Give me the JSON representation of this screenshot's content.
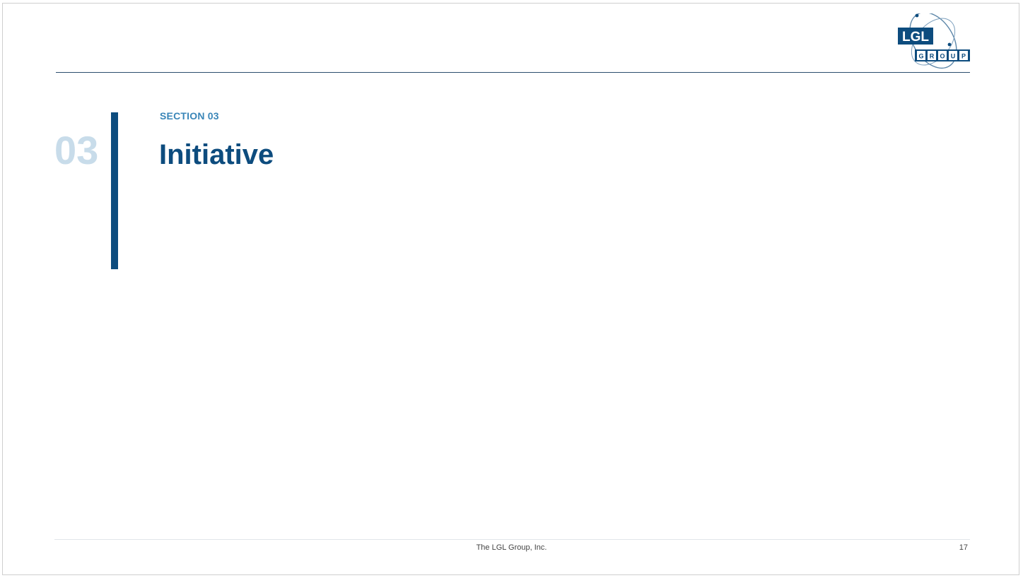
{
  "logo": {
    "line1": "LGL",
    "line2_letters": [
      "G",
      "R",
      "O",
      "U",
      "P"
    ],
    "icon": "lgl-orbit-logo",
    "colors": {
      "primary": "#0d4c7e",
      "orbit": "#5c86a8"
    }
  },
  "section": {
    "number": "03",
    "label": "SECTION 03",
    "title": "Initiative"
  },
  "footer": {
    "company": "The LGL Group, Inc.",
    "page_number": "17"
  },
  "colors": {
    "accent": "#0d4c7e",
    "label": "#3a86b8",
    "number_watermark": "#c8dcea"
  }
}
